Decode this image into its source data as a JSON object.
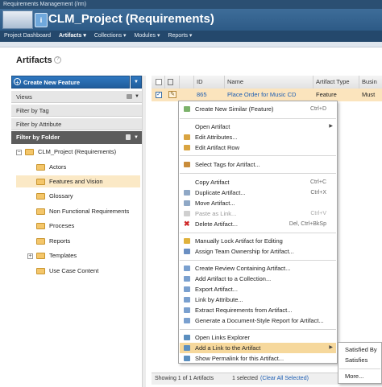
{
  "app": {
    "window_title": "Requirements Management (/rm)",
    "project_title": "CLM_Project (Requirements)"
  },
  "nav": {
    "items": [
      {
        "label": "Project Dashboard"
      },
      {
        "label": "Artifacts ▾"
      },
      {
        "label": "Collections ▾"
      },
      {
        "label": "Modules ▾"
      },
      {
        "label": "Reports ▾"
      }
    ]
  },
  "page": {
    "title": "Artifacts",
    "help": "?"
  },
  "left": {
    "create_label": "Create New Feature",
    "sections": {
      "views": "Views",
      "filter_tag": "Filter by Tag",
      "filter_attr": "Filter by Attribute",
      "filter_folder": "Filter by Folder"
    },
    "tree": {
      "root": "CLM_Project (Requirements)",
      "items": [
        "Actors",
        "Features and Vision",
        "Glossary",
        "Non Functional Requirements",
        "Proceses",
        "Reports",
        "Templates",
        "Use Case Content"
      ]
    }
  },
  "table": {
    "headers": {
      "id": "ID",
      "name": "Name",
      "type": "Artifact Type",
      "busi": "Busin"
    },
    "row": {
      "id": "865",
      "name": "Place Order for Music CD",
      "type": "Feature",
      "busi": "Must"
    },
    "footer_showing": "Showing 1 of 1 Artifacts",
    "footer_selected": "1 selected",
    "footer_clear": "(Clear All Selected)"
  },
  "menu": {
    "items": [
      {
        "label": "Create New Similar (Feature)",
        "shortcut": "Ctrl+D"
      },
      {
        "label": "Open Artifact"
      },
      {
        "label": "Edit Attributes..."
      },
      {
        "label": "Edit Artifact Row"
      },
      {
        "label": "Select Tags for Artifact..."
      },
      {
        "label": "Copy Artifact",
        "shortcut": "Ctrl+C"
      },
      {
        "label": "Duplicate Artifact...",
        "shortcut": "Ctrl+X"
      },
      {
        "label": "Move Artifact..."
      },
      {
        "label": "Paste as Link...",
        "shortcut": "Ctrl+V"
      },
      {
        "label": "Delete Artifact...",
        "shortcut": "Del, Ctrl+BkSp"
      },
      {
        "label": "Manually Lock Artifact for Editing"
      },
      {
        "label": "Assign Team Ownership for Artifact..."
      },
      {
        "label": "Create Review Containing Artifact..."
      },
      {
        "label": "Add Artifact to a Collection..."
      },
      {
        "label": "Export Artifact..."
      },
      {
        "label": "Link by Attribute..."
      },
      {
        "label": "Extract Requirements from Artifact..."
      },
      {
        "label": "Generate a Document-Style Report for Artifact..."
      },
      {
        "label": "Open Links Explorer"
      },
      {
        "label": "Add a Link to the Artifact"
      },
      {
        "label": "Show Permalink for this Artifact..."
      }
    ]
  },
  "submenu": {
    "items": [
      "Satisfied By",
      "Satisfies",
      "More..."
    ]
  },
  "colors": {
    "banner": "#2d5a86",
    "accent_blue": "#205d9c",
    "highlight": "#f6d89c",
    "selected_row": "#fbe4bd"
  }
}
